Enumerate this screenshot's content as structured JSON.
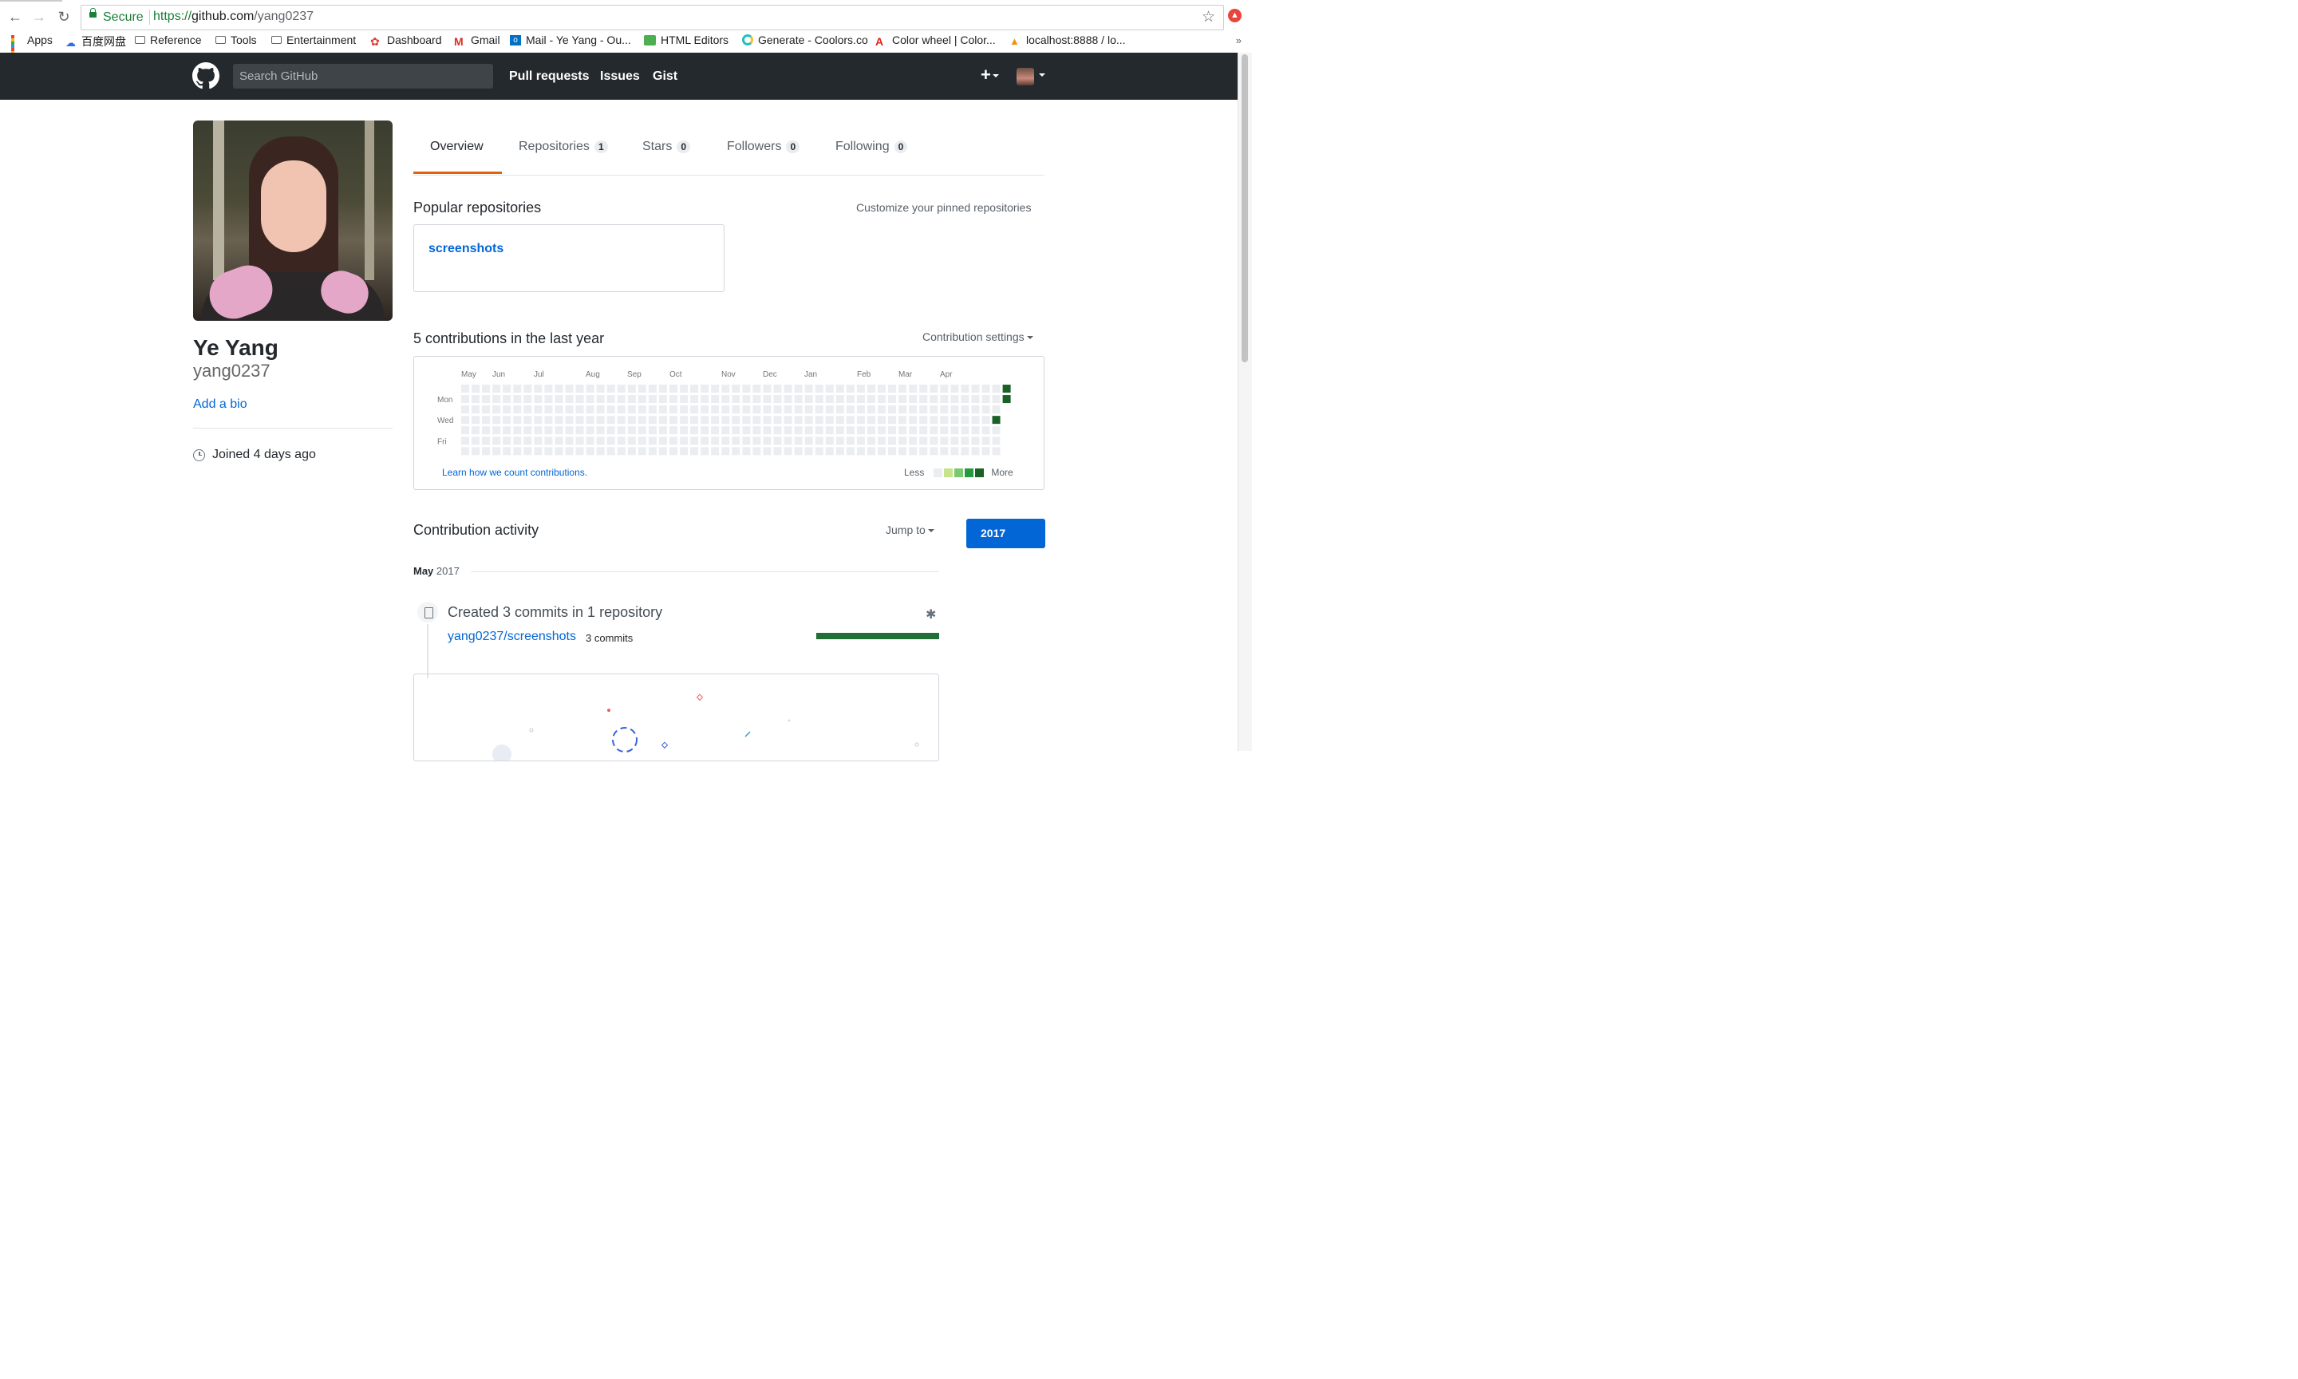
{
  "browser": {
    "secure_label": "Secure",
    "url_protocol": "https://",
    "url_host": "github.com",
    "url_path": "/yang0237",
    "bookmarks": [
      {
        "label": "Apps",
        "icon": "apps-grid-icon"
      },
      {
        "label": "百度网盘",
        "icon": "baidu-cloud-icon"
      },
      {
        "label": "Reference",
        "icon": "folder-icon"
      },
      {
        "label": "Tools",
        "icon": "folder-icon"
      },
      {
        "label": "Entertainment",
        "icon": "folder-icon"
      },
      {
        "label": "Dashboard",
        "icon": "dashboard-icon"
      },
      {
        "label": "Gmail",
        "icon": "gmail-icon"
      },
      {
        "label": "Mail - Ye Yang - Ou...",
        "icon": "outlook-icon"
      },
      {
        "label": "HTML Editors",
        "icon": "html-editors-icon"
      },
      {
        "label": "Generate - Coolors.co",
        "icon": "coolors-icon"
      },
      {
        "label": "Color wheel | Color...",
        "icon": "adobe-icon"
      },
      {
        "label": "localhost:8888 / lo...",
        "icon": "phpmyadmin-icon"
      }
    ],
    "more": "»"
  },
  "header": {
    "search_placeholder": "Search GitHub",
    "nav": [
      "Pull requests",
      "Issues",
      "Gist"
    ],
    "plus": "+"
  },
  "profile": {
    "name": "Ye Yang",
    "login": "yang0237",
    "add_bio": "Add a bio",
    "joined": "Joined 4 days ago"
  },
  "tabs": [
    {
      "label": "Overview",
      "count": null,
      "selected": true
    },
    {
      "label": "Repositories",
      "count": "1"
    },
    {
      "label": "Stars",
      "count": "0"
    },
    {
      "label": "Followers",
      "count": "0"
    },
    {
      "label": "Following",
      "count": "0"
    }
  ],
  "popular": {
    "title": "Popular repositories",
    "customize": "Customize your pinned repositories",
    "repos": [
      "screenshots"
    ]
  },
  "contributions": {
    "title": "5 contributions in the last year",
    "settings": "Contribution settings",
    "months": [
      "May",
      "Jun",
      "Jul",
      "Aug",
      "Sep",
      "Oct",
      "Nov",
      "Dec",
      "Jan",
      "Feb",
      "Mar",
      "Apr"
    ],
    "days": [
      "Mon",
      "Wed",
      "Fri"
    ],
    "learn": "Learn how we count contributions.",
    "less": "Less",
    "more": "More",
    "colors": [
      "#ebedf0",
      "#c6e48b",
      "#7bc96f",
      "#239a3b",
      "#196127"
    ],
    "weeks": 53,
    "active_cells": [
      {
        "week": 51,
        "day": 3,
        "level": 4
      },
      {
        "week": 52,
        "day": 0,
        "level": 4
      },
      {
        "week": 52,
        "day": 1,
        "level": 4
      }
    ]
  },
  "activity": {
    "title": "Contribution activity",
    "jump_to": "Jump to",
    "year": "2017",
    "month_bold": "May",
    "month_year": "2017",
    "summary": "Created 3 commits in 1 repository",
    "repo": "yang0237/screenshots",
    "commits": "3 commits",
    "progress": 1.0
  }
}
